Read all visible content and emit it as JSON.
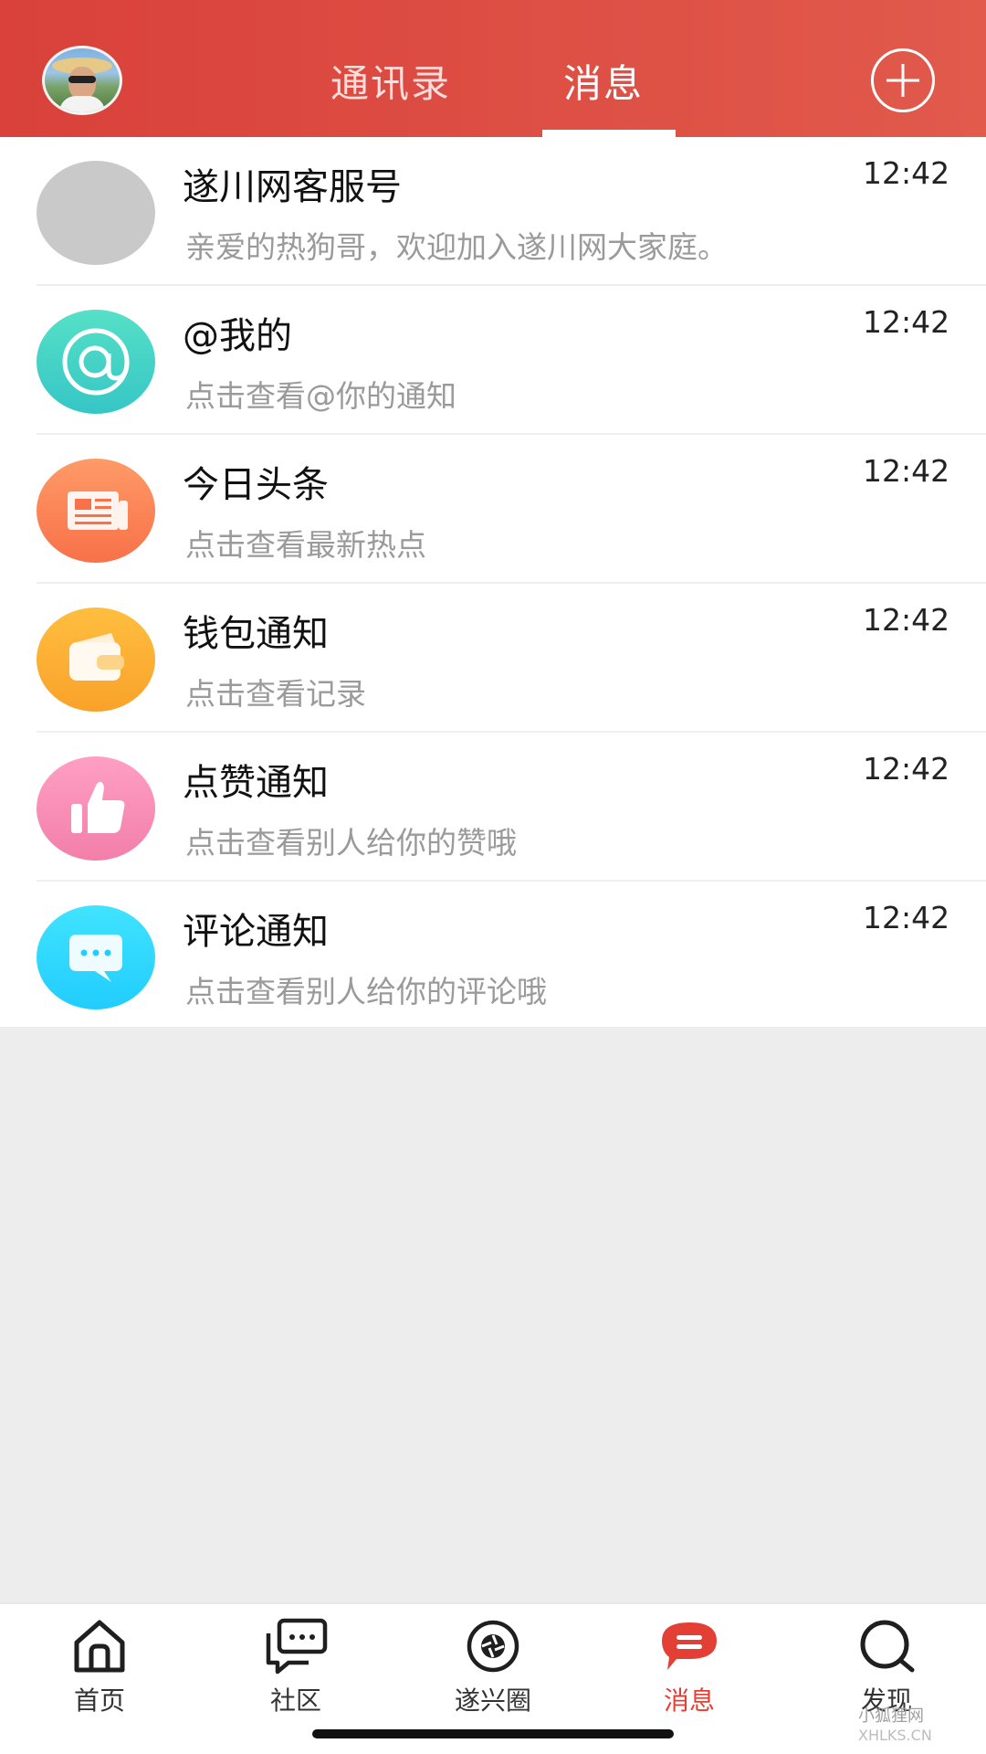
{
  "header": {
    "tabs": [
      {
        "label": "通讯录",
        "active": false
      },
      {
        "label": "消息",
        "active": true
      }
    ],
    "accent_color": "#d9413a"
  },
  "messages": [
    {
      "title": "遂川网客服号",
      "preview": "亲爱的热狗哥，欢迎加入遂川网大家庭。",
      "time": "12:42",
      "icon": "gray-avatar"
    },
    {
      "title": "@我的",
      "preview": "点击查看@你的通知",
      "time": "12:42",
      "icon": "at-icon"
    },
    {
      "title": "今日头条",
      "preview": "点击查看最新热点",
      "time": "12:42",
      "icon": "newspaper-icon"
    },
    {
      "title": "钱包通知",
      "preview": "点击查看记录",
      "time": "12:42",
      "icon": "wallet-icon"
    },
    {
      "title": "点赞通知",
      "preview": "点击查看别人给你的赞哦",
      "time": "12:42",
      "icon": "thumbs-up-icon"
    },
    {
      "title": "评论通知",
      "preview": "点击查看别人给你的评论哦",
      "time": "12:42",
      "icon": "comment-icon"
    }
  ],
  "bottom_nav": [
    {
      "label": "首页",
      "icon": "home-icon",
      "active": false
    },
    {
      "label": "社区",
      "icon": "chat-bubble-icon",
      "active": false
    },
    {
      "label": "遂兴圈",
      "icon": "aperture-icon",
      "active": false
    },
    {
      "label": "消息",
      "icon": "message-icon",
      "active": true
    },
    {
      "label": "发现",
      "icon": "discover-icon",
      "active": false
    }
  ],
  "watermark": {
    "line1": "小狐狸网",
    "line2": "XHLKS.CN"
  }
}
